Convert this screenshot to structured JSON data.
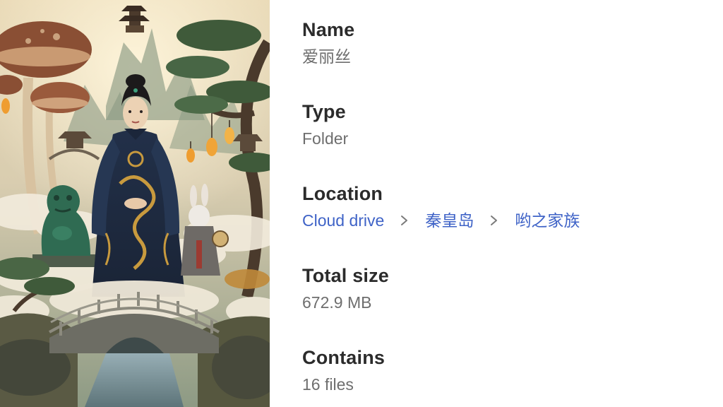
{
  "name": {
    "label": "Name",
    "value": "爱丽丝"
  },
  "type": {
    "label": "Type",
    "value": "Folder"
  },
  "location": {
    "label": "Location",
    "path": [
      "Cloud drive",
      "秦皇岛",
      "哟之家族"
    ],
    "separator_icon": "chevron-right-icon"
  },
  "total_size": {
    "label": "Total size",
    "value": "672.9 MB"
  },
  "contains": {
    "label": "Contains",
    "value": "16 files"
  },
  "colors": {
    "label": "#2b2b2b",
    "value": "#6e6e6e",
    "link": "#3f63c7"
  }
}
